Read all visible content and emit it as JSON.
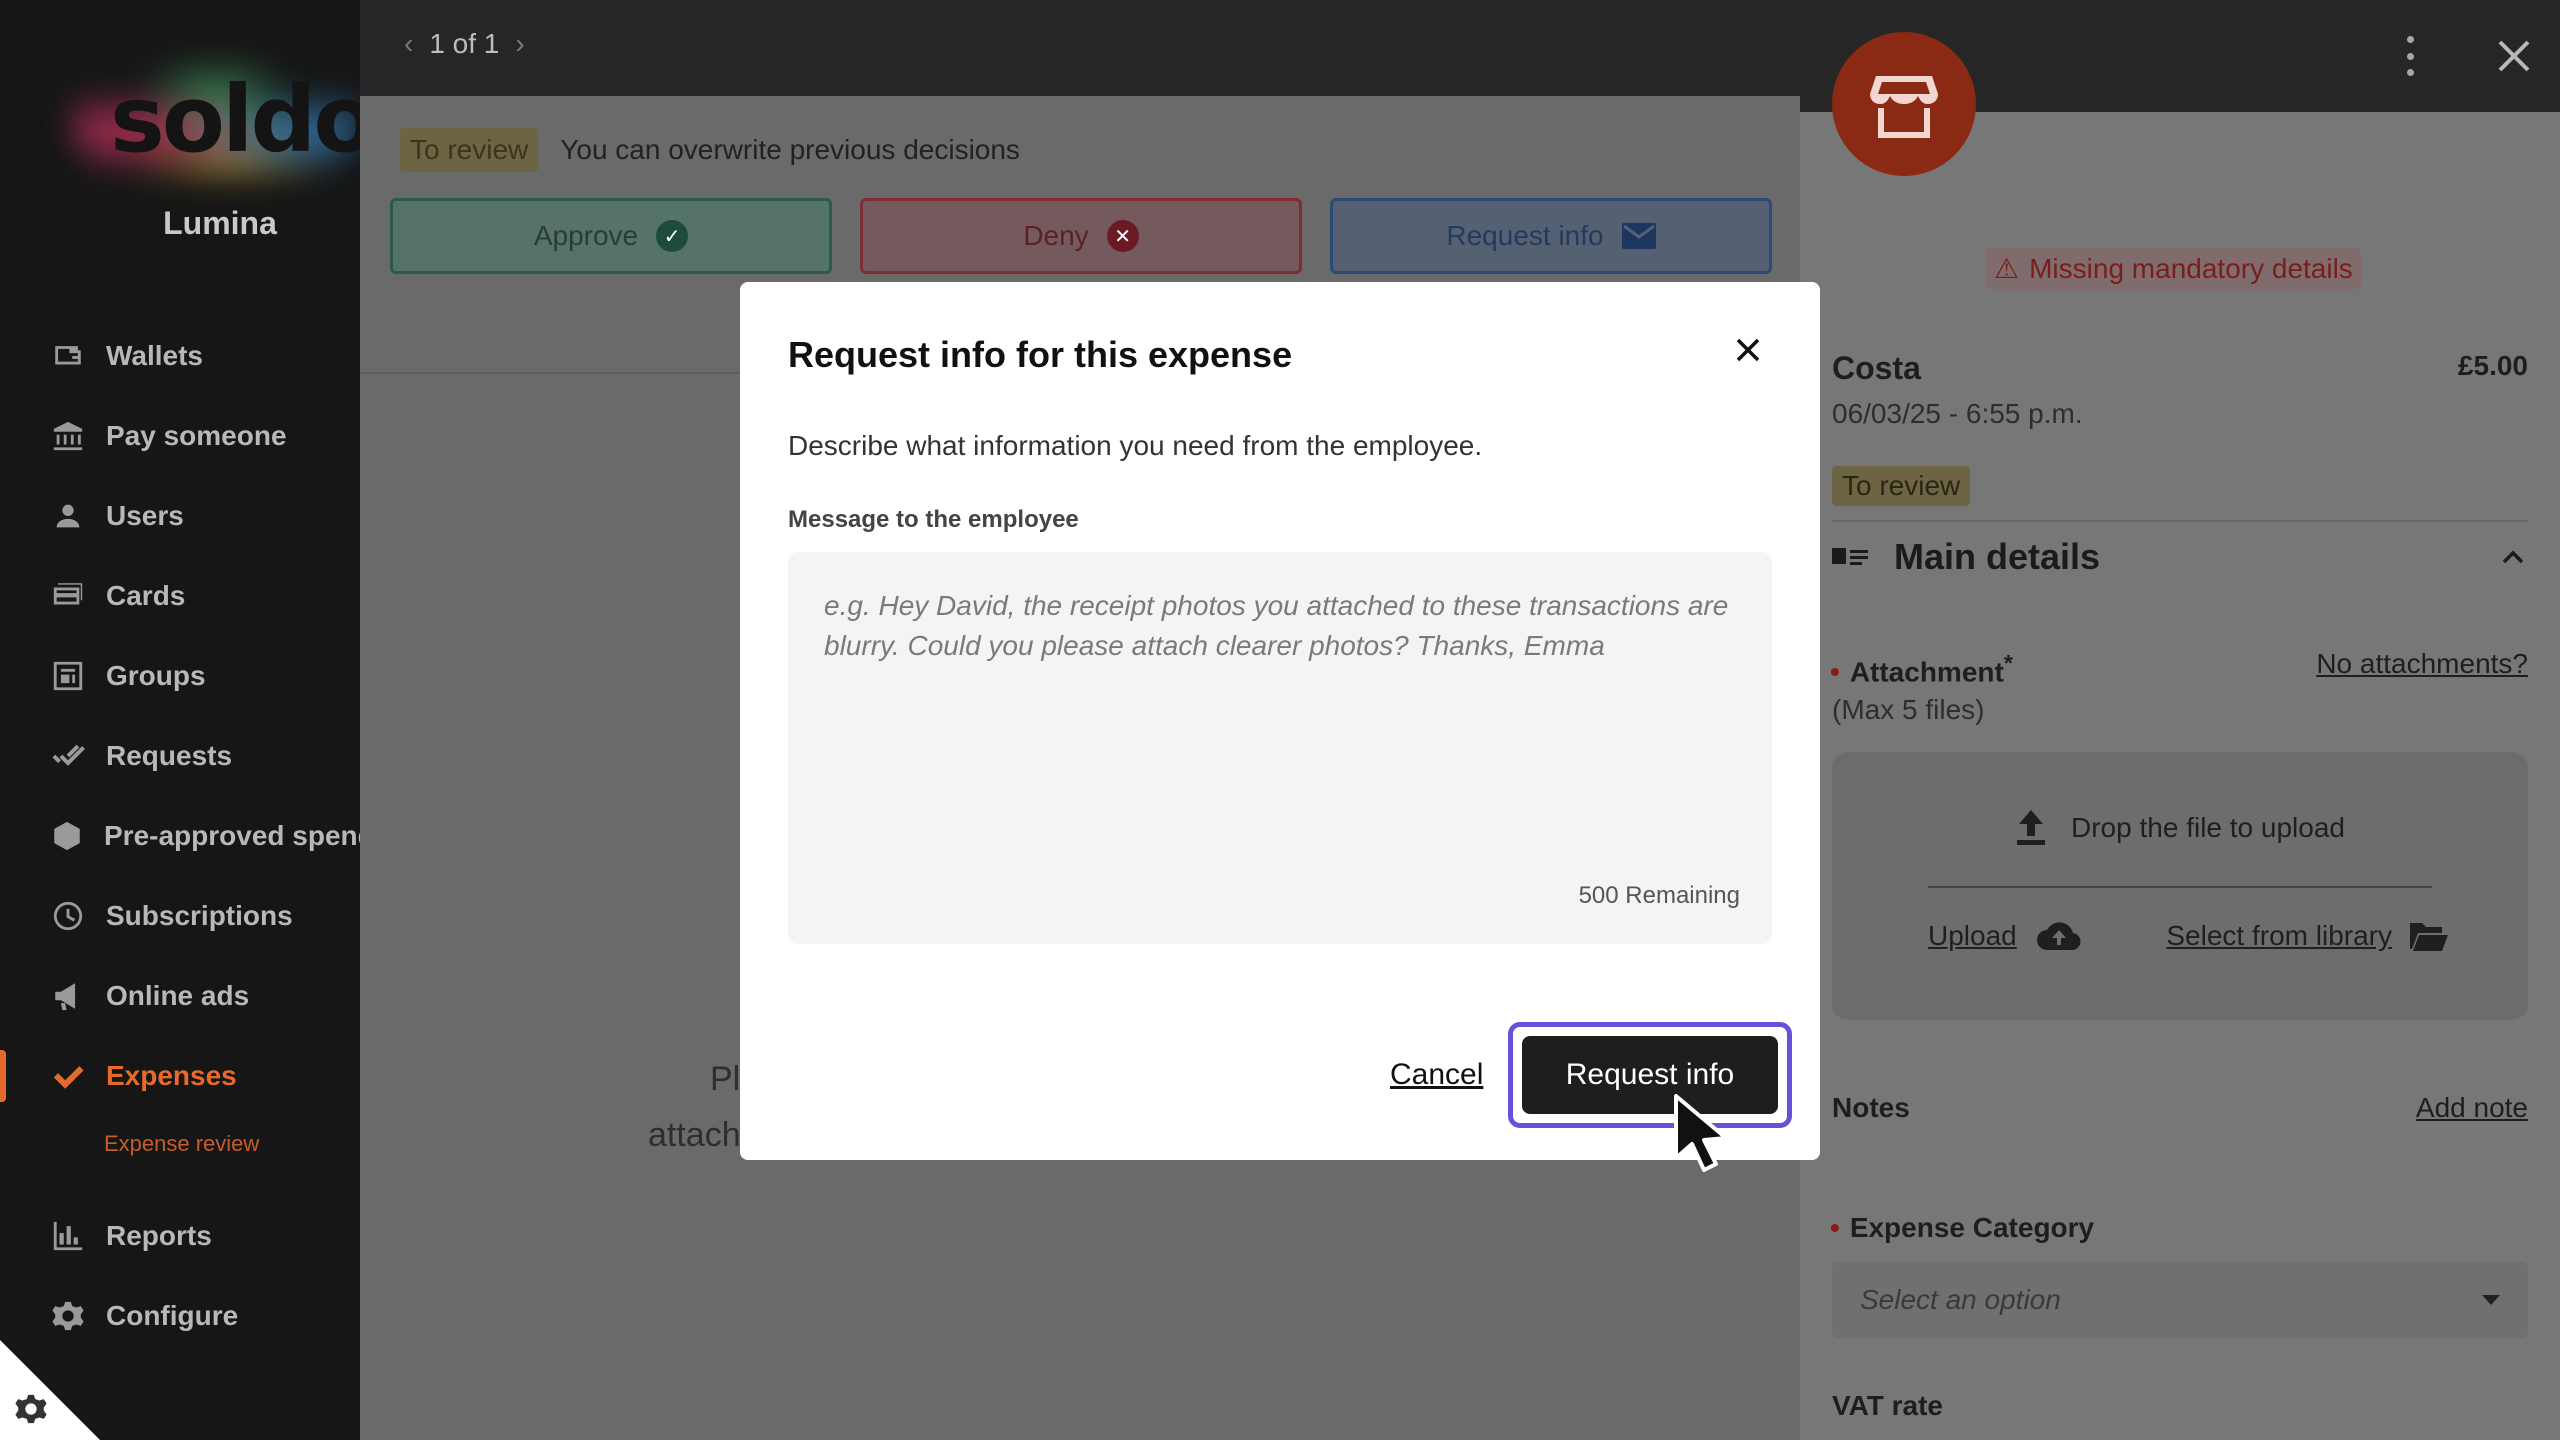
{
  "sidebar": {
    "logo_text": "soldo",
    "org_name": "Lumina",
    "items": [
      {
        "label": "Wallets",
        "icon": "wallet-icon"
      },
      {
        "label": "Pay someone",
        "icon": "bank-icon"
      },
      {
        "label": "Users",
        "icon": "user-icon"
      },
      {
        "label": "Cards",
        "icon": "cards-icon"
      },
      {
        "label": "Groups",
        "icon": "groups-icon"
      },
      {
        "label": "Requests",
        "icon": "double-check-icon"
      },
      {
        "label": "Pre-approved spend",
        "icon": "shield-icon"
      },
      {
        "label": "Subscriptions",
        "icon": "clock-icon"
      },
      {
        "label": "Online ads",
        "icon": "megaphone-icon"
      },
      {
        "label": "Expenses",
        "icon": "check-icon",
        "active": true
      },
      {
        "label": "Reports",
        "icon": "bar-chart-icon"
      },
      {
        "label": "Configure",
        "icon": "gear-icon"
      }
    ],
    "sub_item": "Expense review"
  },
  "main": {
    "pager": {
      "text": "1 of 1"
    },
    "status": {
      "pill": "To review",
      "note": "You can overwrite previous decisions"
    },
    "actions": {
      "approve": "Approve",
      "deny": "Deny",
      "request_info": "Request info"
    },
    "behind_left": "Pl",
    "behind_left2": "attach"
  },
  "right": {
    "missing": "Missing mandatory details",
    "merchant": "Costa",
    "amount": "£5.00",
    "datetime": "06/03/25 - 6:55 p.m.",
    "status_pill": "To review",
    "section_title": "Main details",
    "attachment_label": "Attachment",
    "attachment_required": "*",
    "attachment_max": "(Max 5 files)",
    "no_attachments": "No attachments?",
    "drop_text": "Drop the file to upload",
    "upload": "Upload",
    "select_library": "Select from library",
    "notes": "Notes",
    "add_note": "Add note",
    "expense_category": "Expense Category",
    "select_placeholder": "Select an option",
    "vat_rate": "VAT rate"
  },
  "modal": {
    "title": "Request info for this expense",
    "description": "Describe what information you need from the employee.",
    "field_label": "Message to the employee",
    "placeholder": "e.g. Hey David, the receipt photos you attached to these transactions are blurry. Could you please attach clearer photos? Thanks, Emma",
    "value": "",
    "remaining": "500 Remaining",
    "cancel": "Cancel",
    "submit": "Request info"
  },
  "colors": {
    "accent": "#e66a2c",
    "focus_ring": "#6a4fd8",
    "primary_button": "#1e1e1e"
  }
}
